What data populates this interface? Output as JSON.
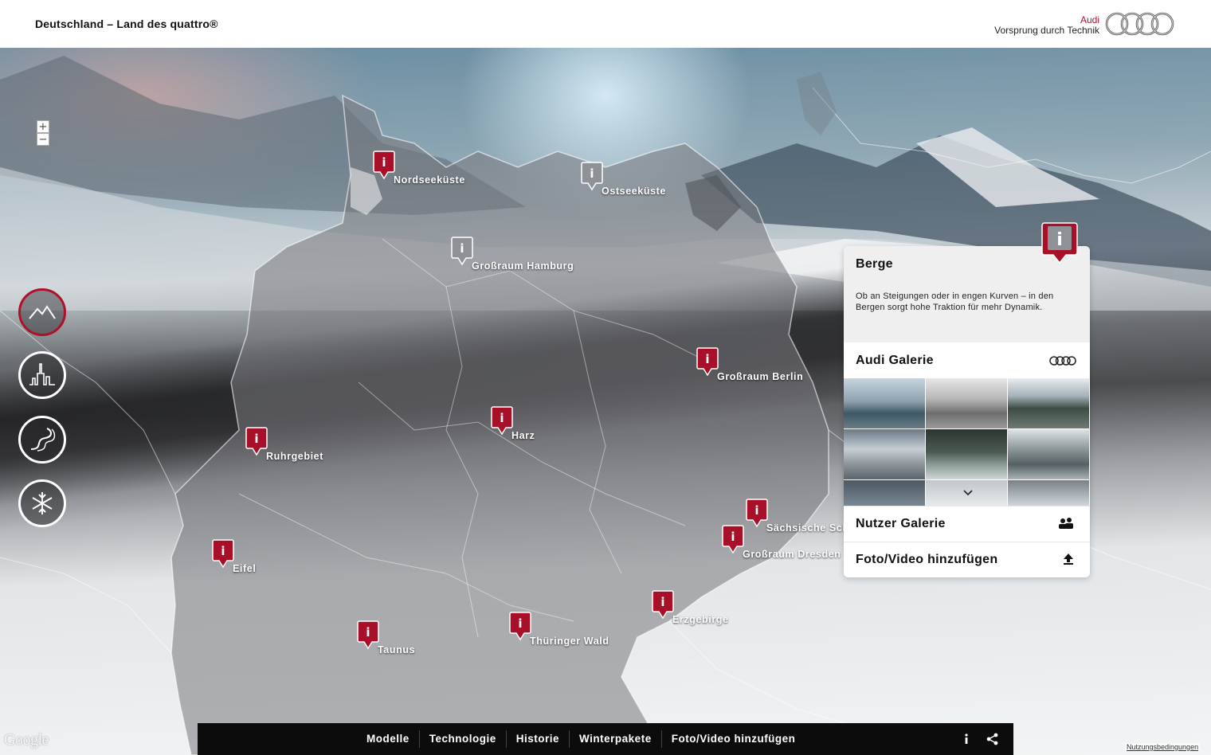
{
  "header": {
    "title": "Deutschland – Land des quattro®",
    "brand_name": "Audi",
    "brand_slogan": "Vorsprung durch Technik",
    "logo_icon": "audi-rings-icon"
  },
  "map": {
    "zoom_in_label": "+",
    "zoom_out_label": "−",
    "google_logo": "Google",
    "terms_link": "Nutzungsbedingungen",
    "categories": [
      {
        "icon": "mountain-icon",
        "active": true
      },
      {
        "icon": "city-skyline-icon",
        "active": false
      },
      {
        "icon": "curvy-road-icon",
        "active": false
      },
      {
        "icon": "snowflake-icon",
        "active": false
      }
    ],
    "markers": [
      {
        "label": "Nordseeküste",
        "color": "red"
      },
      {
        "label": "Ostseeküste",
        "color": "grey"
      },
      {
        "label": "Großraum Hamburg",
        "color": "grey"
      },
      {
        "label": "Großraum Berlin",
        "color": "red"
      },
      {
        "label": "Harz",
        "color": "red"
      },
      {
        "label": "Ruhrgebiet",
        "color": "red"
      },
      {
        "label": "Sächsische Schweiz",
        "color": "red"
      },
      {
        "label": "Großraum Dresden",
        "color": "red"
      },
      {
        "label": "Eifel",
        "color": "red"
      },
      {
        "label": "Erzgebirge",
        "color": "red"
      },
      {
        "label": "Thüringer Wald",
        "color": "red"
      },
      {
        "label": "Taunus",
        "color": "red"
      }
    ]
  },
  "panel": {
    "title": "Berge",
    "description": "Ob an Steigungen oder in engen Kurven – in den Bergen sorgt hohe Traktion für mehr Dynamik.",
    "audi_gallery_label": "Audi Galerie",
    "user_gallery_label": "Nutzer Galerie",
    "add_media_label": "Foto/Video hinzufügen"
  },
  "bottom_nav": {
    "items": [
      "Modelle",
      "Technologie",
      "Historie",
      "Winterpakete",
      "Foto/Video hinzufügen"
    ],
    "info_icon": "info-icon",
    "share_icon": "share-icon"
  },
  "colors": {
    "accent": "#b0102a",
    "marker_grey": "#8e9297",
    "nav_bg": "#0c0c0c"
  }
}
